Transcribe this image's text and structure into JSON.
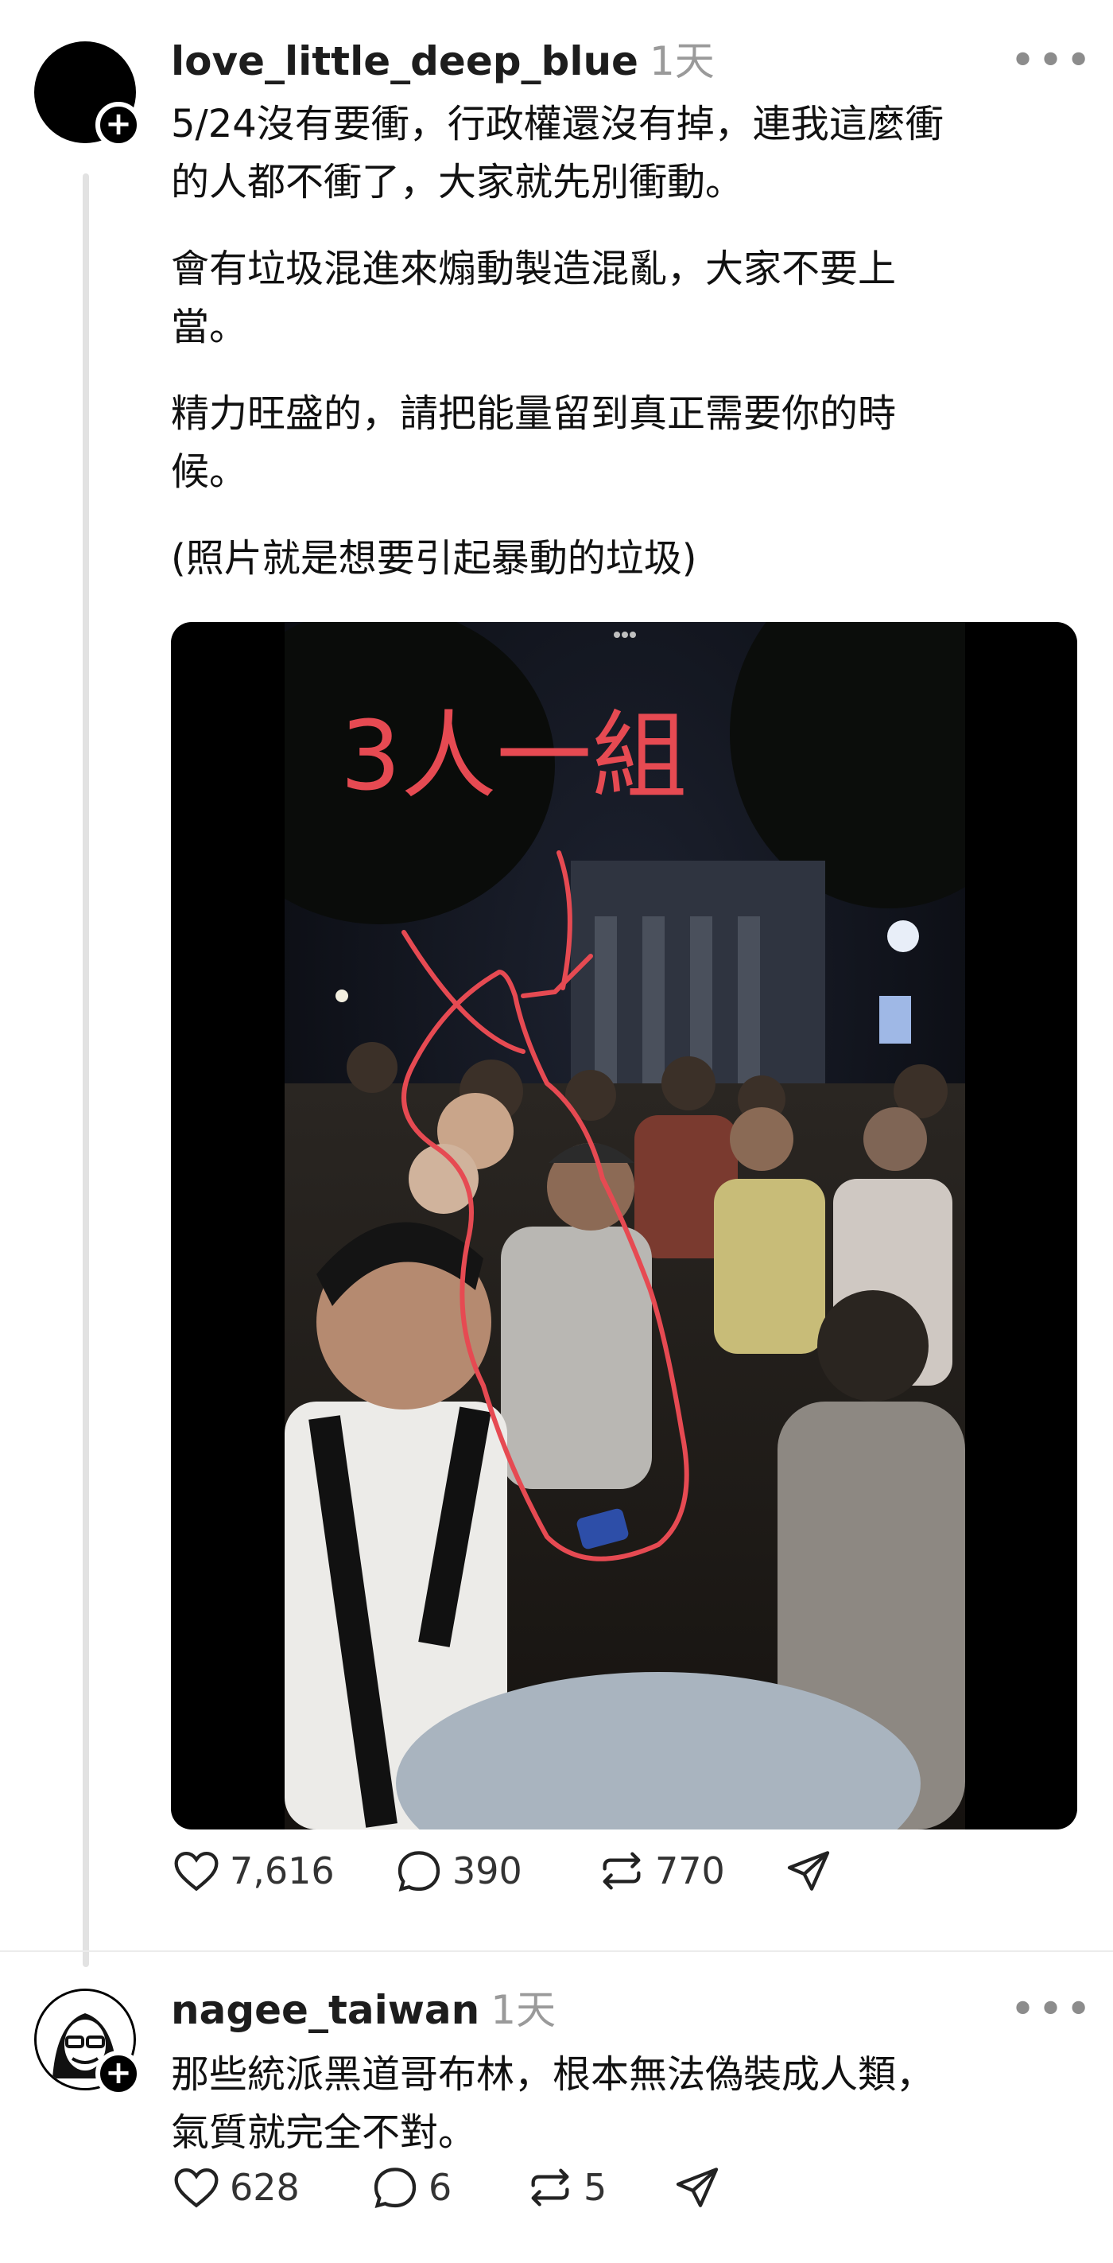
{
  "posts": [
    {
      "username": "love_little_deep_blue",
      "time": "1天",
      "paragraphs": [
        "5/24沒有要衝，行政權還沒有掉，連我這麼衝\n的人都不衝了，大家就先別衝動。",
        "會有垃圾混進來煽動製造混亂，大家不要上\n當。",
        "精力旺盛的，請把能量留到真正需要你的時\n候。",
        "(照片就是想要引起暴動的垃圾)"
      ],
      "image_annotation": "3人一組",
      "likes": "7,616",
      "replies": "390",
      "reposts": "770"
    },
    {
      "username": "nagee_taiwan",
      "time": "1天",
      "paragraphs": [
        "那些統派黑道哥布林，根本無法偽裝成人類，\n氣質就完全不對。"
      ],
      "likes": "628",
      "replies": "6",
      "reposts": "5"
    }
  ],
  "icons": {
    "follow": "+",
    "more": "•••"
  }
}
